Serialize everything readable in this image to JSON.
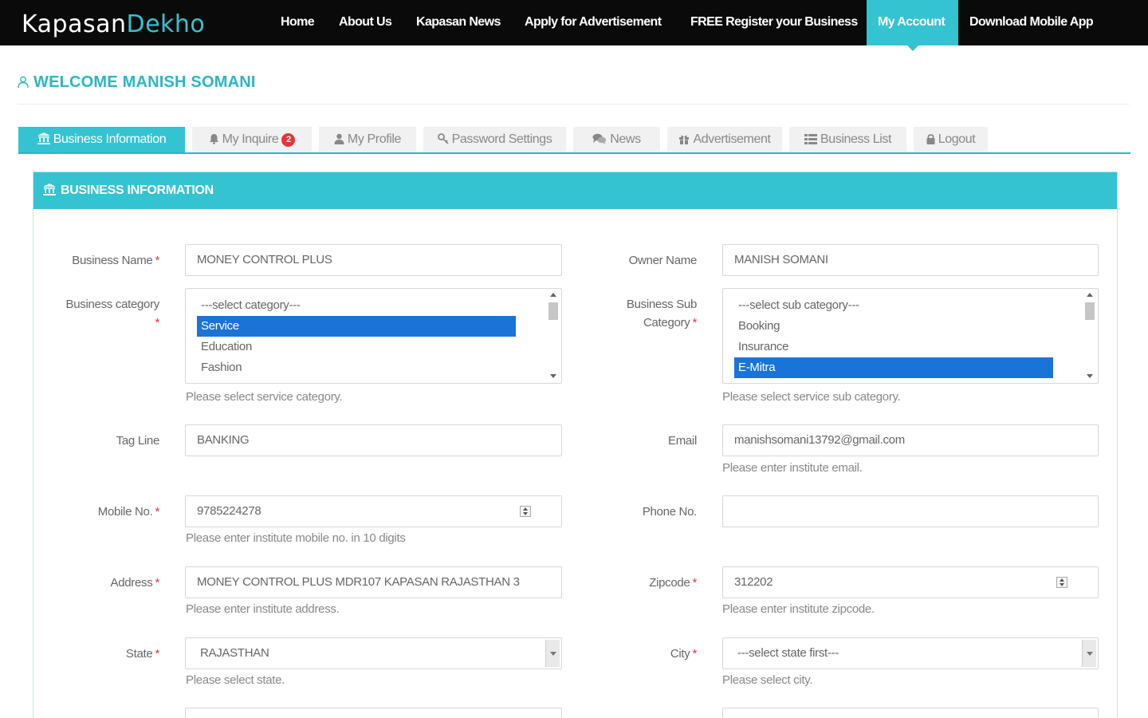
{
  "brand": {
    "logo_part1": "Kapasan",
    "logo_part2": "Dekho"
  },
  "nav": {
    "home": "Home",
    "about": "About Us",
    "news": "Kapasan News",
    "apply_ad": "Apply for Advertisement",
    "register": "FREE Register your Business",
    "my_account": "My Account",
    "download": "Download Mobile App"
  },
  "welcome": "WELCOME MANISH SOMANI",
  "tabs": {
    "business_info": "Business Information",
    "my_inquire": "My Inquire",
    "inquire_count": "2",
    "my_profile": "My Profile",
    "password": "Password Settings",
    "news": "News",
    "advertisement": "Advertisement",
    "business_list": "Business List",
    "logout": "Logout"
  },
  "panel_title": "BUSINESS INFORMATION",
  "form": {
    "business_name": {
      "label": "Business Name",
      "value": "MONEY CONTROL PLUS"
    },
    "owner_name": {
      "label": "Owner Name",
      "value": "MANISH SOMANI"
    },
    "business_category": {
      "label": "Business category",
      "options": [
        "---select category---",
        "Service",
        "Education",
        "Fashion"
      ],
      "help": "Please select service category."
    },
    "business_sub_category": {
      "label_line1": "Business Sub",
      "label_line2": "Category",
      "options": [
        "---select sub category---",
        "Booking",
        "Insurance",
        "E-Mitra"
      ],
      "help": "Please select service sub category."
    },
    "tag_line": {
      "label": "Tag Line",
      "value": "BANKING"
    },
    "email": {
      "label": "Email",
      "value": "manishsomani13792@gmail.com",
      "help": "Please enter institute email."
    },
    "mobile": {
      "label": "Mobile No.",
      "value": "9785224278",
      "help": "Please enter institute mobile no. in 10 digits"
    },
    "phone": {
      "label": "Phone No.",
      "value": ""
    },
    "address": {
      "label": "Address",
      "value": "MONEY CONTROL PLUS MDR107 KAPASAN RAJASTHAN 3",
      "help": "Please enter institute address."
    },
    "zipcode": {
      "label": "Zipcode",
      "value": "312202",
      "help": "Please enter institute zipcode."
    },
    "state": {
      "label": "State",
      "value": "RAJASTHAN",
      "help": "Please select state."
    },
    "city": {
      "label": "City",
      "value": "---select state first---",
      "help": "Please select city."
    },
    "required_mark": "*"
  },
  "colors": {
    "accent": "#34c3d1",
    "heading": "#2bb6c4",
    "navbar": "#0a0a0a",
    "selection": "#1a74d8",
    "required": "#e8333b"
  }
}
